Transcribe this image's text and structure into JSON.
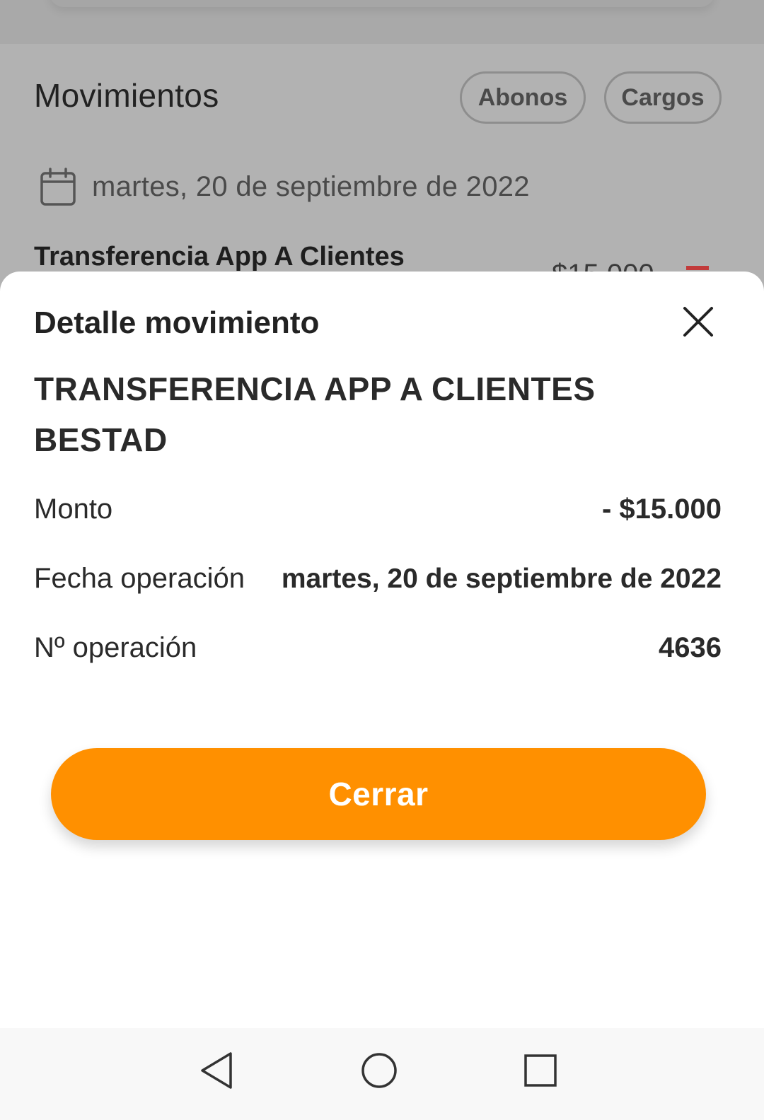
{
  "background": {
    "section_title": "Movimientos",
    "filters": [
      "Abonos",
      "Cargos"
    ],
    "date": "martes, 20 de septiembre de 2022",
    "transaction": {
      "title": "Transferencia App A Clientes",
      "amount_partial": "$15.000"
    }
  },
  "sheet": {
    "title": "Detalle movimiento",
    "transaction_name": "TRANSFERENCIA APP A CLIENTES BESTAD",
    "details": [
      {
        "label": "Monto",
        "value": "- $15.000"
      },
      {
        "label": "Fecha operación",
        "value": "martes, 20 de septiembre de 2022"
      },
      {
        "label": "Nº operación",
        "value": "4636"
      }
    ],
    "close_button_label": "Cerrar"
  },
  "icons": {
    "calendar": "calendar-icon",
    "close": "close-icon",
    "nav_back": "back-triangle-icon",
    "nav_home": "home-circle-icon",
    "nav_recent": "recent-square-icon"
  },
  "colors": {
    "accent": "#ff9000",
    "overlay": "#b2b2b2",
    "debit_indicator": "#c23b3b"
  }
}
